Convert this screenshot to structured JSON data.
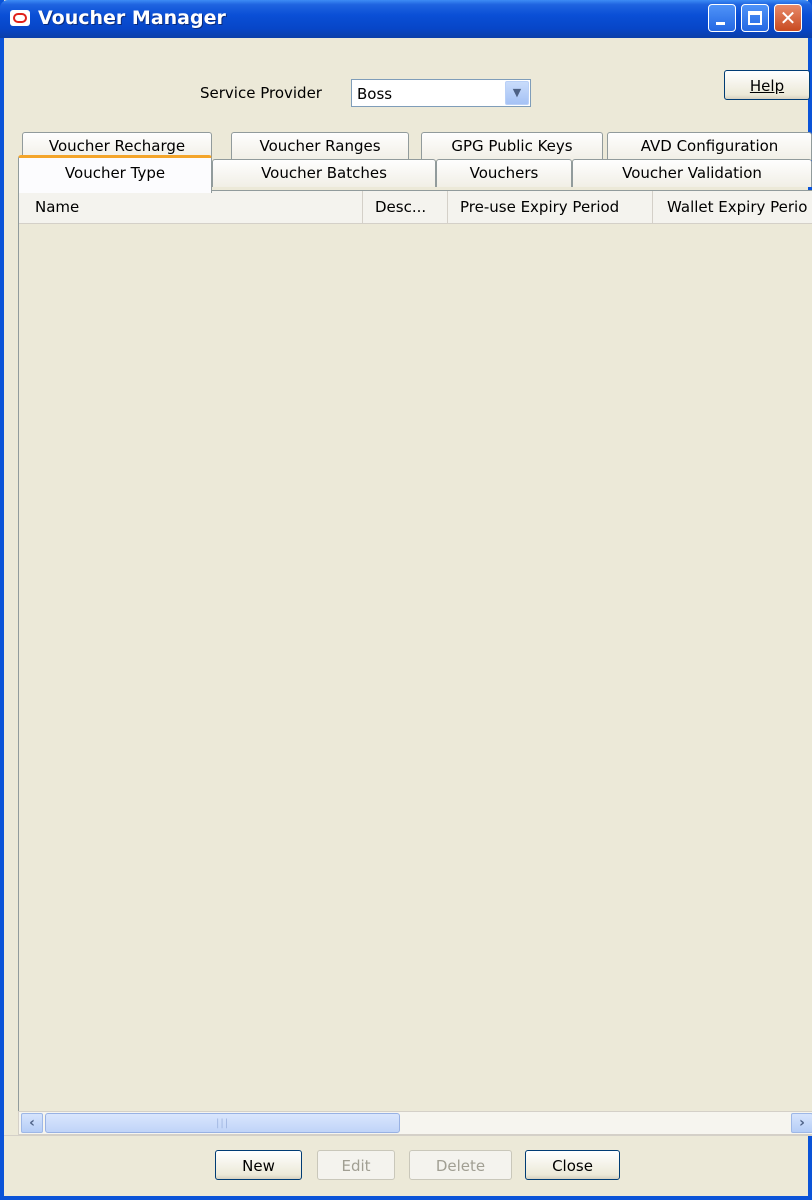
{
  "window": {
    "title": "Voucher Manager"
  },
  "controls": {
    "service_provider_label": "Service Provider",
    "service_provider_value": "Boss",
    "help_label": "Help"
  },
  "tabs": {
    "back_row": [
      {
        "label": "Voucher Recharge"
      },
      {
        "label": "Voucher Ranges"
      },
      {
        "label": "GPG Public Keys"
      },
      {
        "label": "AVD Configuration"
      }
    ],
    "front_row": [
      {
        "label": "Voucher Type",
        "active": true
      },
      {
        "label": "Voucher Batches"
      },
      {
        "label": "Vouchers"
      },
      {
        "label": "Voucher Validation"
      }
    ]
  },
  "table": {
    "columns": [
      "Name",
      "Desc...",
      "Pre-use Expiry Period",
      "Wallet Expiry Perio"
    ],
    "rows": []
  },
  "buttons": {
    "new": "New",
    "edit": "Edit",
    "delete": "Delete",
    "close": "Close"
  },
  "colors": {
    "titlebar": "#0a4fd6",
    "window_bg": "#ece9d8",
    "active_tab_accent": "#f4a52a",
    "close_button": "#c84a20"
  },
  "icons": {
    "app": "oracle-logo-icon",
    "minimize": "minimize-icon",
    "maximize": "maximize-icon",
    "close": "close-icon",
    "dropdown": "chevron-down-icon",
    "scroll_left": "arrow-left-icon",
    "scroll_right": "arrow-right-icon"
  }
}
